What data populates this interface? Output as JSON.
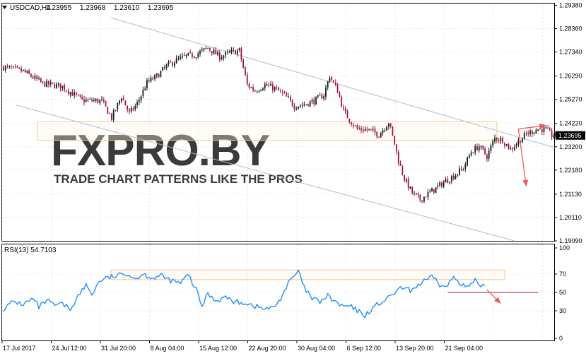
{
  "main_header": {
    "symbol": "USDCAD,H4",
    "open": "1.23955",
    "high": "1.23968",
    "low": "1.23610",
    "close": "1.23695"
  },
  "rsi_header": "RSI(13) 54.7103",
  "watermark": {
    "logo": "FXPRO.BY",
    "tagline": "TRADE CHART PATTERNS LIKE THE PROS"
  },
  "colors": {
    "bull_candle": "#1a1a1a",
    "bear_candle": "#a31538",
    "rsi_line": "#1e90ff",
    "channel_line": "#a9bfd3",
    "zone_border": "#f5c98a",
    "arrow": "#ee5a5a",
    "level_line": "#a31538",
    "grid": "#d8d8d8",
    "price_marker_bg": "#000000"
  },
  "chart_data": [
    {
      "type": "candlestick",
      "symbol": "USDCAD",
      "timeframe": "H4",
      "ylim": [
        1.1909,
        1.2938
      ],
      "y_ticks": [
        "1.29380",
        "1.28360",
        "1.27340",
        "1.26290",
        "1.25270",
        "1.24220",
        "1.23200",
        "1.22180",
        "1.21130",
        "1.20110",
        "1.19090"
      ],
      "current_price": "1.23695",
      "x_tick_labels": [
        "17 Jul 2017",
        "24 Jul 12:00",
        "31 Jul 20:00",
        "8 Aug 04:00",
        "15 Aug 12:00",
        "22 Aug 20:00",
        "30 Aug 04:00",
        "6 Sep 12:00",
        "13 Sep 20:00",
        "21 Sep 04:00"
      ],
      "close_path": [
        [
          0,
          1.2668
        ],
        [
          10,
          1.265
        ],
        [
          20,
          1.2596
        ],
        [
          30,
          1.2583
        ],
        [
          40,
          1.2523
        ],
        [
          50,
          1.252
        ],
        [
          55,
          1.2446
        ],
        [
          60,
          1.254
        ],
        [
          64,
          1.2466
        ],
        [
          68,
          1.2508
        ],
        [
          73,
          1.26
        ],
        [
          78,
          1.2628
        ],
        [
          83,
          1.2673
        ],
        [
          88,
          1.2698
        ],
        [
          93,
          1.2716
        ],
        [
          98,
          1.2723
        ],
        [
          104,
          1.2752
        ],
        [
          110,
          1.2713
        ],
        [
          116,
          1.2733
        ],
        [
          120,
          1.274
        ],
        [
          124,
          1.259
        ],
        [
          128,
          1.2565
        ],
        [
          133,
          1.259
        ],
        [
          138,
          1.2575
        ],
        [
          143,
          1.2545
        ],
        [
          148,
          1.2498
        ],
        [
          153,
          1.2505
        ],
        [
          158,
          1.252
        ],
        [
          163,
          1.2547
        ],
        [
          166,
          1.263
        ],
        [
          170,
          1.2565
        ],
        [
          173,
          1.2478
        ],
        [
          176,
          1.2438
        ],
        [
          180,
          1.2398
        ],
        [
          186,
          1.2393
        ],
        [
          191,
          1.2373
        ],
        [
          196,
          1.2428
        ],
        [
          199,
          1.2333
        ],
        [
          201,
          1.2258
        ],
        [
          204,
          1.218
        ],
        [
          208,
          1.2118
        ],
        [
          212,
          1.2088
        ],
        [
          216,
          1.2115
        ],
        [
          220,
          1.2138
        ],
        [
          224,
          1.2165
        ],
        [
          230,
          1.2198
        ],
        [
          234,
          1.2228
        ],
        [
          238,
          1.2298
        ],
        [
          242,
          1.2323
        ],
        [
          246,
          1.2278
        ],
        [
          250,
          1.2358
        ],
        [
          254,
          1.235
        ],
        [
          258,
          1.2308
        ],
        [
          262,
          1.2343
        ],
        [
          266,
          1.2375
        ],
        [
          272,
          1.2398
        ],
        [
          276,
          1.2395
        ],
        [
          279,
          1.2369
        ]
      ],
      "channel": {
        "upper": [
          [
            0.8,
            1.2948
          ],
          [
            281,
            1.2315
          ]
        ],
        "lower": [
          [
            0.8,
            1.2487
          ],
          [
            260,
            1.1909
          ]
        ]
      },
      "resistance_zone": [
        1.243,
        1.2348
      ],
      "projection_arrows": [
        [
          [
            262,
            1.2398
          ],
          [
            276,
            1.2413
          ]
        ],
        [
          [
            262,
            1.2398
          ],
          [
            266,
            1.2147
          ]
        ]
      ]
    },
    {
      "type": "line",
      "name": "RSI(13)",
      "ylim": [
        0,
        100
      ],
      "y_ticks": [
        "100",
        "70",
        "50",
        "30",
        "0"
      ],
      "last_value": "54.7103",
      "x_tick_labels": [
        "17 Jul 2017",
        "24 Jul 12:00",
        "31 Jul 20:00",
        "8 Aug 04:00",
        "15 Aug 12:00",
        "22 Aug 20:00",
        "30 Aug 04:00",
        "6 Sep 12:00",
        "13 Sep 20:00",
        "21 Sep 04:00"
      ],
      "path": [
        [
          0,
          32
        ],
        [
          5,
          40
        ],
        [
          10,
          37
        ],
        [
          15,
          43
        ],
        [
          18,
          34
        ],
        [
          22,
          41
        ],
        [
          26,
          36
        ],
        [
          30,
          37
        ],
        [
          34,
          32
        ],
        [
          38,
          46
        ],
        [
          42,
          58
        ],
        [
          45,
          48
        ],
        [
          49,
          63
        ],
        [
          53,
          66
        ],
        [
          58,
          68
        ],
        [
          63,
          71
        ],
        [
          67,
          65
        ],
        [
          71,
          70
        ],
        [
          76,
          66
        ],
        [
          80,
          68
        ],
        [
          85,
          63
        ],
        [
          90,
          60
        ],
        [
          94,
          69
        ],
        [
          98,
          53
        ],
        [
          101,
          35
        ],
        [
          104,
          49
        ],
        [
          108,
          41
        ],
        [
          113,
          45
        ],
        [
          118,
          39
        ],
        [
          123,
          39
        ],
        [
          128,
          35
        ],
        [
          133,
          32
        ],
        [
          137,
          33
        ],
        [
          140,
          40
        ],
        [
          145,
          60
        ],
        [
          150,
          73
        ],
        [
          153,
          55
        ],
        [
          157,
          43
        ],
        [
          161,
          40
        ],
        [
          165,
          46
        ],
        [
          168,
          41
        ],
        [
          172,
          35
        ],
        [
          176,
          35
        ],
        [
          180,
          30
        ],
        [
          184,
          25
        ],
        [
          188,
          33
        ],
        [
          191,
          38
        ],
        [
          195,
          42
        ],
        [
          199,
          50
        ],
        [
          203,
          55
        ],
        [
          207,
          52
        ],
        [
          211,
          58
        ],
        [
          215,
          63
        ],
        [
          219,
          67
        ],
        [
          222,
          58
        ],
        [
          225,
          55
        ],
        [
          229,
          67
        ],
        [
          233,
          60
        ],
        [
          236,
          55
        ],
        [
          240,
          63
        ],
        [
          243,
          53
        ],
        [
          245,
          60
        ]
      ],
      "zone": [
        74.5,
        64
      ],
      "level_line": {
        "from": 226,
        "to": 272,
        "value": 50
      },
      "projection_arrow": [
        [
          246,
          53
        ],
        [
          253,
          38
        ]
      ]
    }
  ]
}
